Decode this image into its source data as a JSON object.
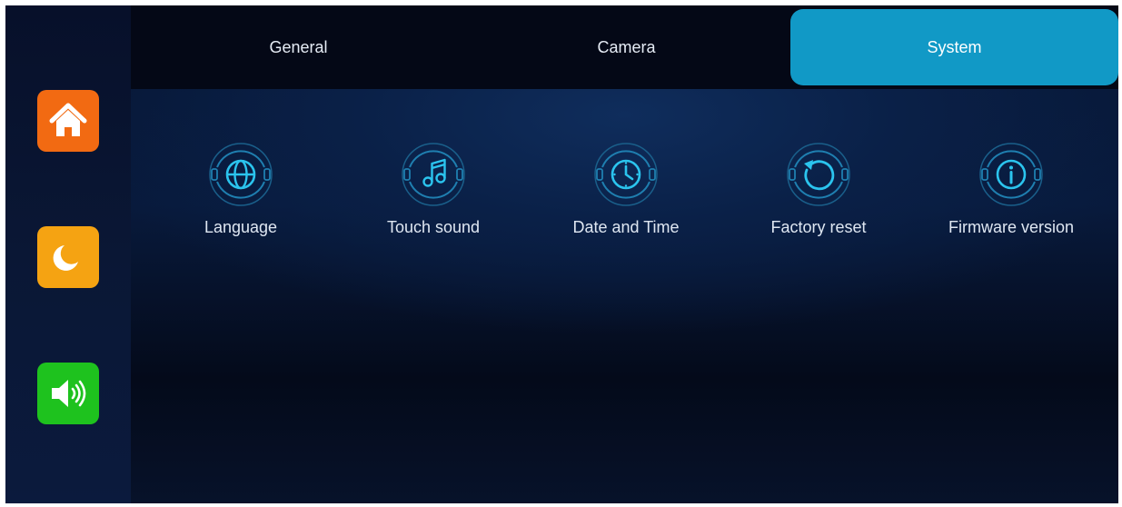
{
  "sidebar": {
    "buttons": [
      {
        "name": "home",
        "icon": "home-icon",
        "color": "#f26a12"
      },
      {
        "name": "night-mode",
        "icon": "moon-icon",
        "color": "#f5a312"
      },
      {
        "name": "volume",
        "icon": "speaker-icon",
        "color": "#1ec21e"
      }
    ]
  },
  "tabs": [
    {
      "label": "General",
      "active": false
    },
    {
      "label": "Camera",
      "active": false
    },
    {
      "label": "System",
      "active": true
    }
  ],
  "system_items": [
    {
      "label": "Language",
      "icon": "globe-icon"
    },
    {
      "label": "Touch sound",
      "icon": "music-note-icon"
    },
    {
      "label": "Date and Time",
      "icon": "clock-icon"
    },
    {
      "label": "Factory reset",
      "icon": "reset-icon"
    },
    {
      "label": "Firmware version",
      "icon": "info-icon"
    }
  ],
  "colors": {
    "accent": "#1199c6",
    "icon_stroke": "#2bc4ee"
  }
}
